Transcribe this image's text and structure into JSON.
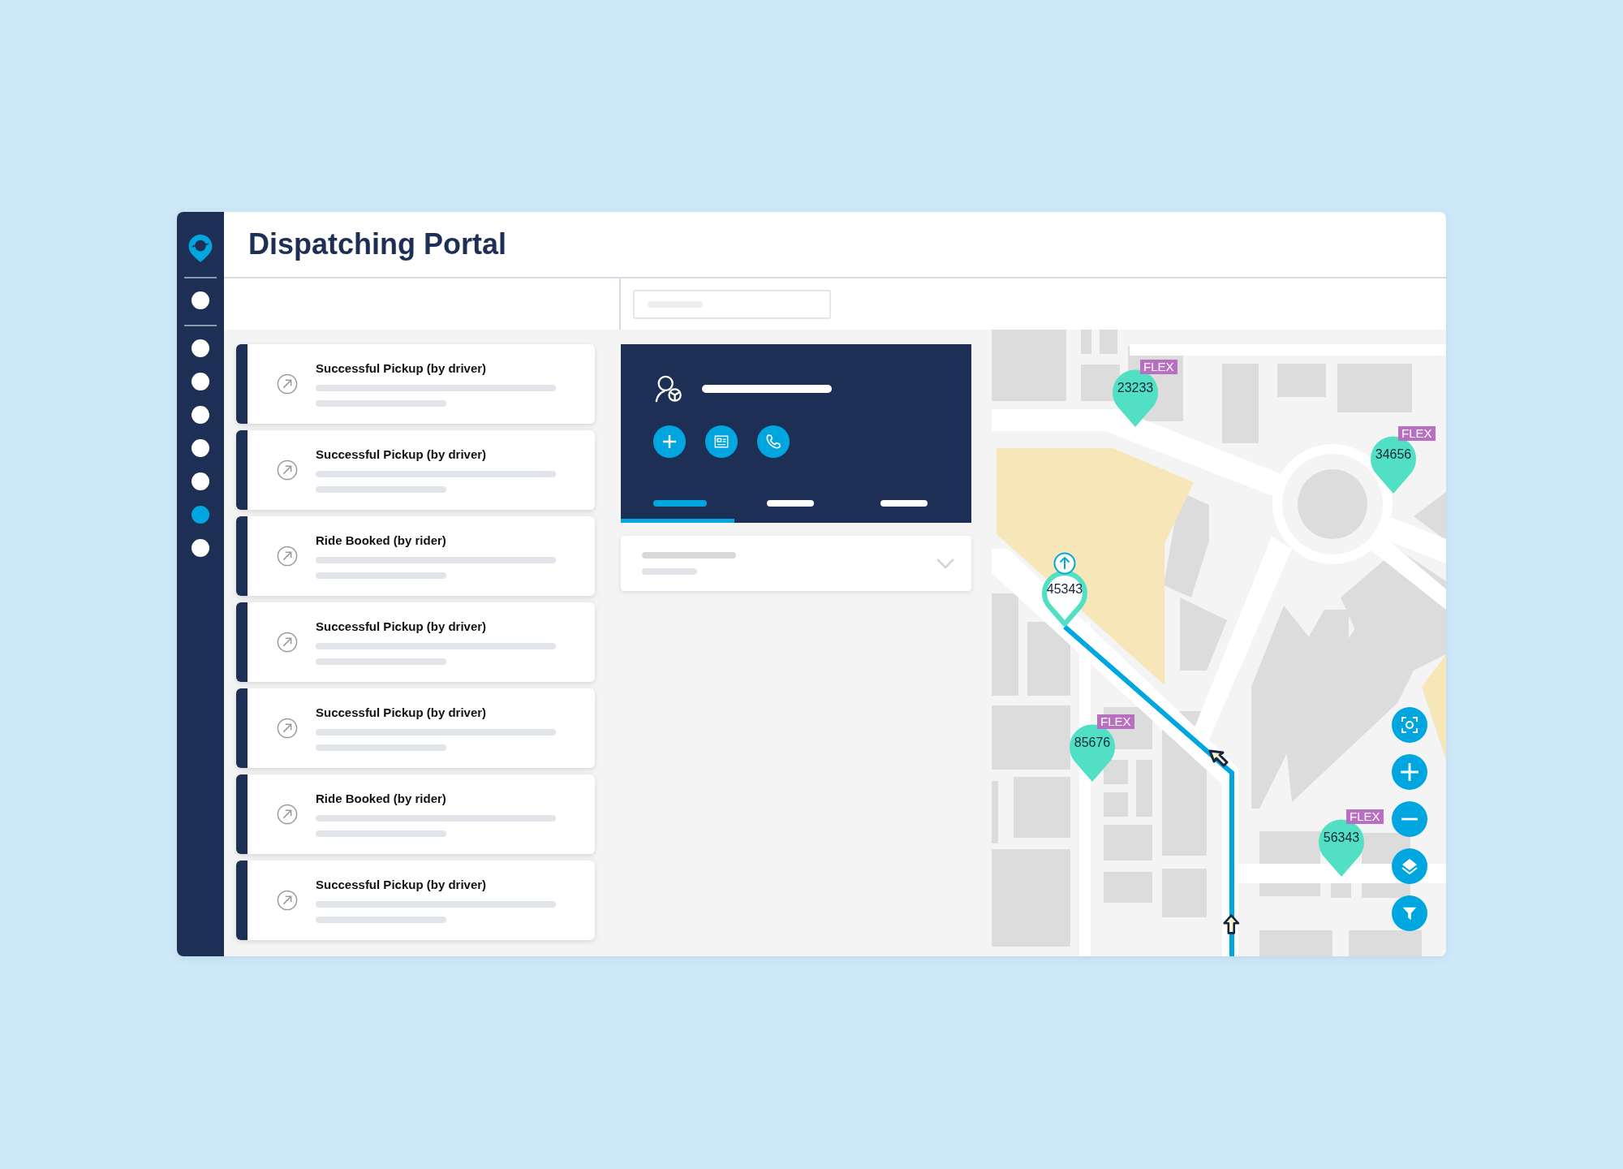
{
  "window": {
    "title": "Dispatching Portal"
  },
  "sidebar": {
    "top_items": [
      {
        "selected": false
      }
    ],
    "items": [
      {
        "selected": false
      },
      {
        "selected": false
      },
      {
        "selected": false
      },
      {
        "selected": false
      },
      {
        "selected": false
      },
      {
        "selected": true
      },
      {
        "selected": false
      }
    ]
  },
  "events": [
    {
      "title": "Successful Pickup (by driver)"
    },
    {
      "title": "Successful Pickup (by driver)"
    },
    {
      "title": "Ride Booked (by rider)"
    },
    {
      "title": "Successful Pickup (by driver)"
    },
    {
      "title": "Successful Pickup (by driver)"
    },
    {
      "title": "Ride Booked (by rider)"
    },
    {
      "title": "Successful Pickup (by driver)"
    }
  ],
  "driver_panel": {
    "tabs": [
      {
        "selected": true
      },
      {
        "selected": false
      },
      {
        "selected": false
      }
    ]
  },
  "map": {
    "pins": [
      {
        "number": "23233",
        "badge": "FLEX",
        "selected": false
      },
      {
        "number": "34656",
        "badge": "FLEX",
        "selected": false
      },
      {
        "number": "45343",
        "selected": true
      },
      {
        "number": "85676",
        "badge": "FLEX",
        "selected": false
      },
      {
        "number": "56343",
        "badge": "FLEX",
        "selected": false
      }
    ]
  }
}
